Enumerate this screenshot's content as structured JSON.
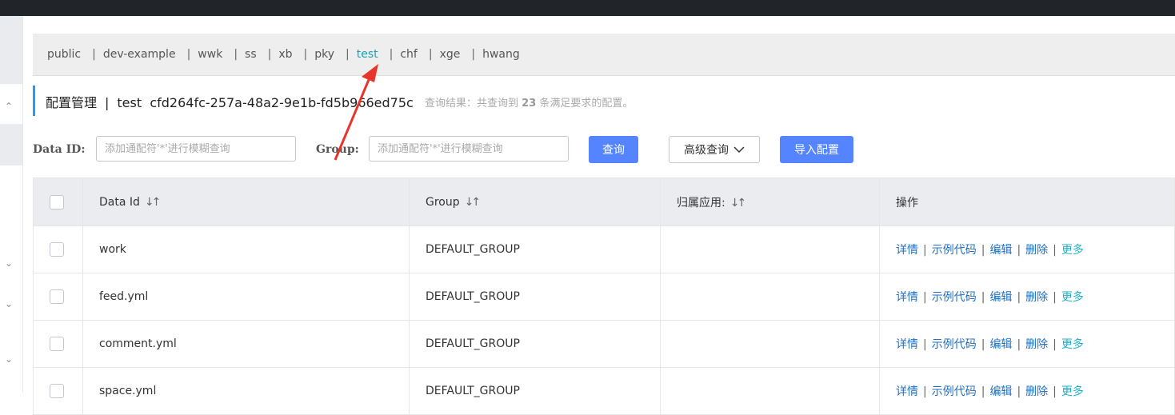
{
  "namespaces": [
    {
      "label": "public",
      "active": false
    },
    {
      "label": "dev-example",
      "active": false
    },
    {
      "label": "wwk",
      "active": false
    },
    {
      "label": "ss",
      "active": false
    },
    {
      "label": "xb",
      "active": false
    },
    {
      "label": "pky",
      "active": false
    },
    {
      "label": "test",
      "active": true
    },
    {
      "label": "chf",
      "active": false
    },
    {
      "label": "xge",
      "active": false
    },
    {
      "label": "hwang",
      "active": false
    }
  ],
  "separator": "|",
  "page": {
    "title": "配置管理",
    "namespace": "test",
    "namespace_id": "cfd264fc-257a-48a2-9e1b-fd5b966ed75c",
    "result_prefix": "查询结果：共查询到",
    "result_count": "23",
    "result_suffix": "条满足要求的配置。"
  },
  "search": {
    "data_id_label": "Data ID:",
    "data_id_placeholder": "添加通配符'*'进行模糊查询",
    "group_label": "Group:",
    "group_placeholder": "添加通配符'*'进行模糊查询",
    "query_button": "查询",
    "advanced_button": "高级查询",
    "import_button": "导入配置"
  },
  "table": {
    "headers": {
      "data_id": "Data Id",
      "group": "Group",
      "app": "归属应用:",
      "ops": "操作"
    },
    "rows": [
      {
        "data_id": "work",
        "group": "DEFAULT_GROUP",
        "app": ""
      },
      {
        "data_id": "feed.yml",
        "group": "DEFAULT_GROUP",
        "app": ""
      },
      {
        "data_id": "comment.yml",
        "group": "DEFAULT_GROUP",
        "app": ""
      },
      {
        "data_id": "space.yml",
        "group": "DEFAULT_GROUP",
        "app": ""
      }
    ],
    "ops": {
      "detail": "详情",
      "sample": "示例代码",
      "edit": "编辑",
      "delete": "删除",
      "more": "更多"
    }
  },
  "icons": {
    "sort": "sort-icon",
    "chevron": "chevron-down-icon",
    "annotation": "red-arrow-annotation"
  },
  "colors": {
    "active_tab": "#17a2b8",
    "primary": "#5584ff",
    "link": "#1c6fc9",
    "more_link": "#20b0c8",
    "annotation": "#e8352b"
  }
}
